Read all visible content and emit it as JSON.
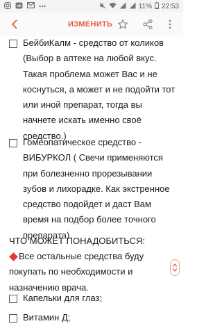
{
  "status_bar": {
    "battery": "11%",
    "time": "22:53"
  },
  "toolbar": {
    "edit_label": "ИЗМЕНИТЬ"
  },
  "items": [
    {
      "text": "БейбиКалм - средство от коликов (Выбор в аптеке на любой вкус. Такая проблема может Вас и не коснуться, а может и не подойти тот или иной препарат, тогда вы начнете искать именно своё средство.)"
    },
    {
      "text": "Гомеопатическое средство - ВИБУРКОЛ ( Свечи применяются при болезненно прорезывании зубов и лихорадке. Как экстренное средство подойдет и даст Вам время на подбор более точного препарата)."
    }
  ],
  "section_title": "ЧТО МОЖЕТ ПОНАДОБИТЬСЯ:",
  "note": "Все остальные средства буду покупать по необходимости и назначению врача.",
  "items2": [
    {
      "text": "Капельки для глаз;"
    },
    {
      "text": "Витамин Д;"
    }
  ]
}
